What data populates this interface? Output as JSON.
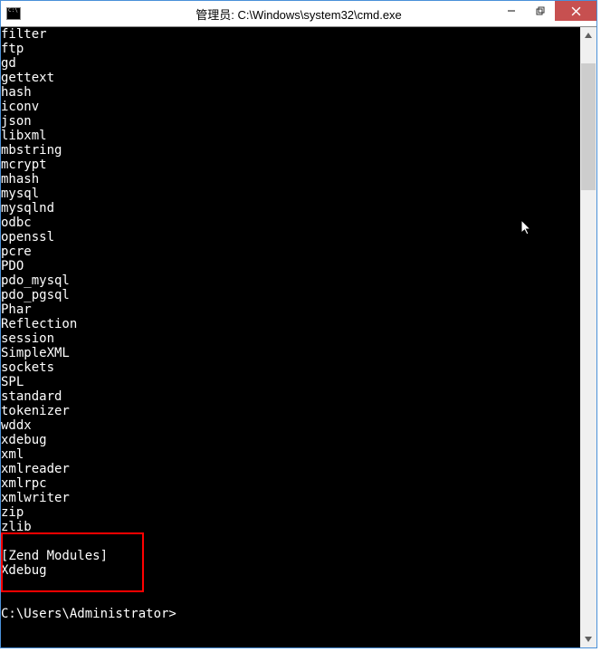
{
  "window": {
    "title": "管理员: C:\\Windows\\system32\\cmd.exe"
  },
  "terminal": {
    "lines": [
      "filter",
      "ftp",
      "gd",
      "gettext",
      "hash",
      "iconv",
      "json",
      "libxml",
      "mbstring",
      "mcrypt",
      "mhash",
      "mysql",
      "mysqlnd",
      "odbc",
      "openssl",
      "pcre",
      "PDO",
      "pdo_mysql",
      "pdo_pgsql",
      "Phar",
      "Reflection",
      "session",
      "SimpleXML",
      "sockets",
      "SPL",
      "standard",
      "tokenizer",
      "wddx",
      "xdebug",
      "xml",
      "xmlreader",
      "xmlrpc",
      "xmlwriter",
      "zip",
      "zlib",
      "",
      "[Zend Modules]",
      "Xdebug",
      "",
      "",
      "C:\\Users\\Administrator>"
    ]
  },
  "highlight": {
    "top_line_index": 35,
    "height_lines": 4,
    "left": 0,
    "width": 158
  }
}
